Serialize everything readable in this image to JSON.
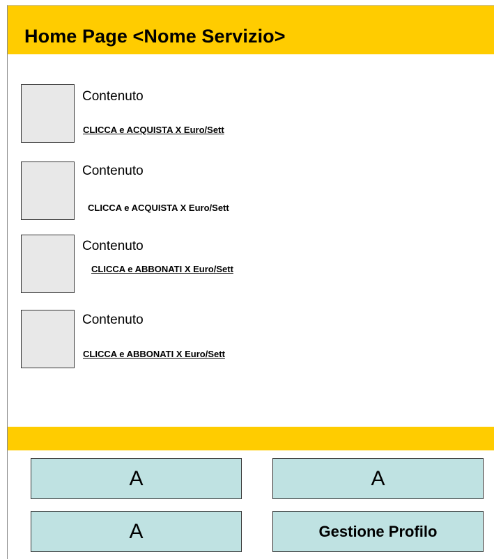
{
  "header": {
    "title": "Home Page <Nome Servizio>"
  },
  "items": [
    {
      "title": "Contenuto",
      "link": "CLICCA e ACQUISTA X Euro/Sett"
    },
    {
      "title": "Contenuto",
      "link": "CLICCA e ACQUISTA  X Euro/Sett"
    },
    {
      "title": "Contenuto",
      "link": "CLICCA e ABBONATI X Euro/Sett"
    },
    {
      "title": "Contenuto",
      "link": "CLICCA e ABBONATI X Euro/Sett"
    }
  ],
  "menu": {
    "buttons": [
      {
        "label": "A"
      },
      {
        "label": "A"
      },
      {
        "label": "A"
      },
      {
        "label": "Gestione Profilo"
      }
    ]
  },
  "colors": {
    "header": "#ffcc00",
    "tile": "#bfe2e2",
    "thumb": "#e8e8e8"
  }
}
